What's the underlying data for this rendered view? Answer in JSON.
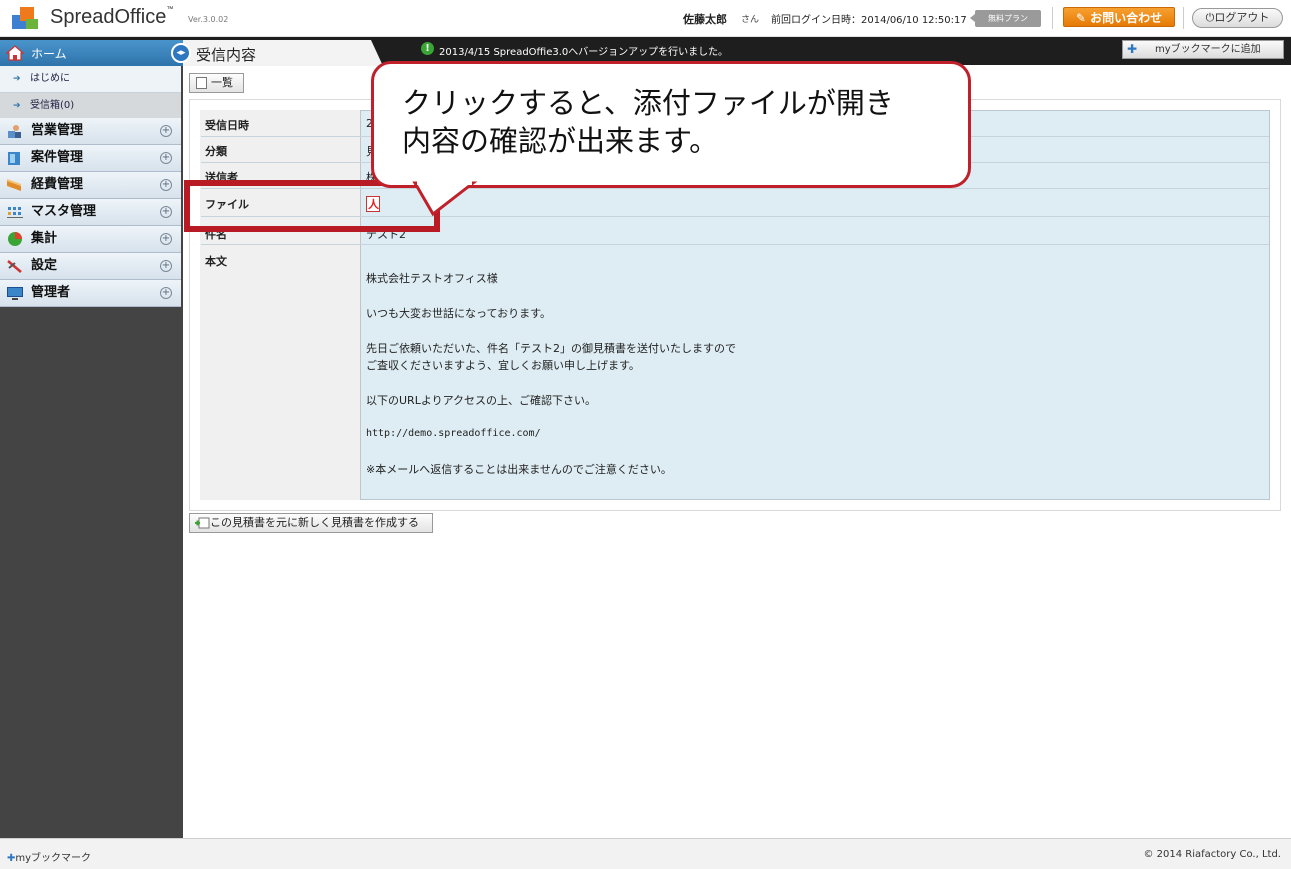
{
  "app": {
    "brand": "SpreadOffice",
    "version": "Ver.3.0.02"
  },
  "header": {
    "user_name": "佐藤太郎",
    "user_suffix": "さん",
    "last_login": "前回ログイン日時：2014/06/10 12:50:17",
    "plan_badge": "無料プラン",
    "contact_label": "お問い合わせ",
    "logout_label": "ログアウト"
  },
  "subbar": {
    "home_label": "ホーム",
    "page_title": "受信内容",
    "news": "2013/4/15 SpreadOffie3.0へバージョンアップを行いました。",
    "bookmark_label": "myブックマークに追加"
  },
  "sidebar": {
    "sub_items": [
      {
        "label": "はじめに",
        "active": false
      },
      {
        "label": "受信箱(0)",
        "active": true
      }
    ],
    "items": [
      {
        "label": "営業管理",
        "icon": "sales-icon"
      },
      {
        "label": "案件管理",
        "icon": "project-icon"
      },
      {
        "label": "経費管理",
        "icon": "expense-icon"
      },
      {
        "label": "マスタ管理",
        "icon": "master-icon"
      },
      {
        "label": "集計",
        "icon": "pie-chart-icon"
      },
      {
        "label": "設定",
        "icon": "tools-icon"
      },
      {
        "label": "管理者",
        "icon": "monitor-icon"
      }
    ]
  },
  "main": {
    "list_button": "一覧",
    "rows": {
      "received_label": "受信日時",
      "received_value": "2",
      "category_label": "分類",
      "category_value": "見",
      "sender_label": "送信者",
      "sender_value": "株",
      "file_label": "ファイル",
      "subject_label": "件名",
      "subject_value": "テスト2",
      "body_label": "本文"
    },
    "body_lines": [
      "株式会社テストオフィス様",
      "いつも大変お世話になっております。",
      "先日ご依頼いただいた、件名「テスト2」の御見積書を送付いたしますので",
      "ご査収くださいますよう、宜しくお願い申し上げます。",
      "以下のURLよりアクセスの上、ご確認下さい。",
      "http://demo.spreadoffice.com/",
      "※本メールへ返信することは出来ませんのでご注意ください。"
    ],
    "create_button": "この見積書を元に新しく見積書を作成する"
  },
  "callout": {
    "line1": "クリックすると、添付ファイルが開き",
    "line2": "内容の確認が出来ます。"
  },
  "footer": {
    "bookmark": "myブックマーク",
    "copyright": "© 2014 Riafactory Co., Ltd."
  },
  "colors": {
    "accent": "#2e74ab",
    "highlight": "#b81b24",
    "contact": "#f08a16"
  }
}
